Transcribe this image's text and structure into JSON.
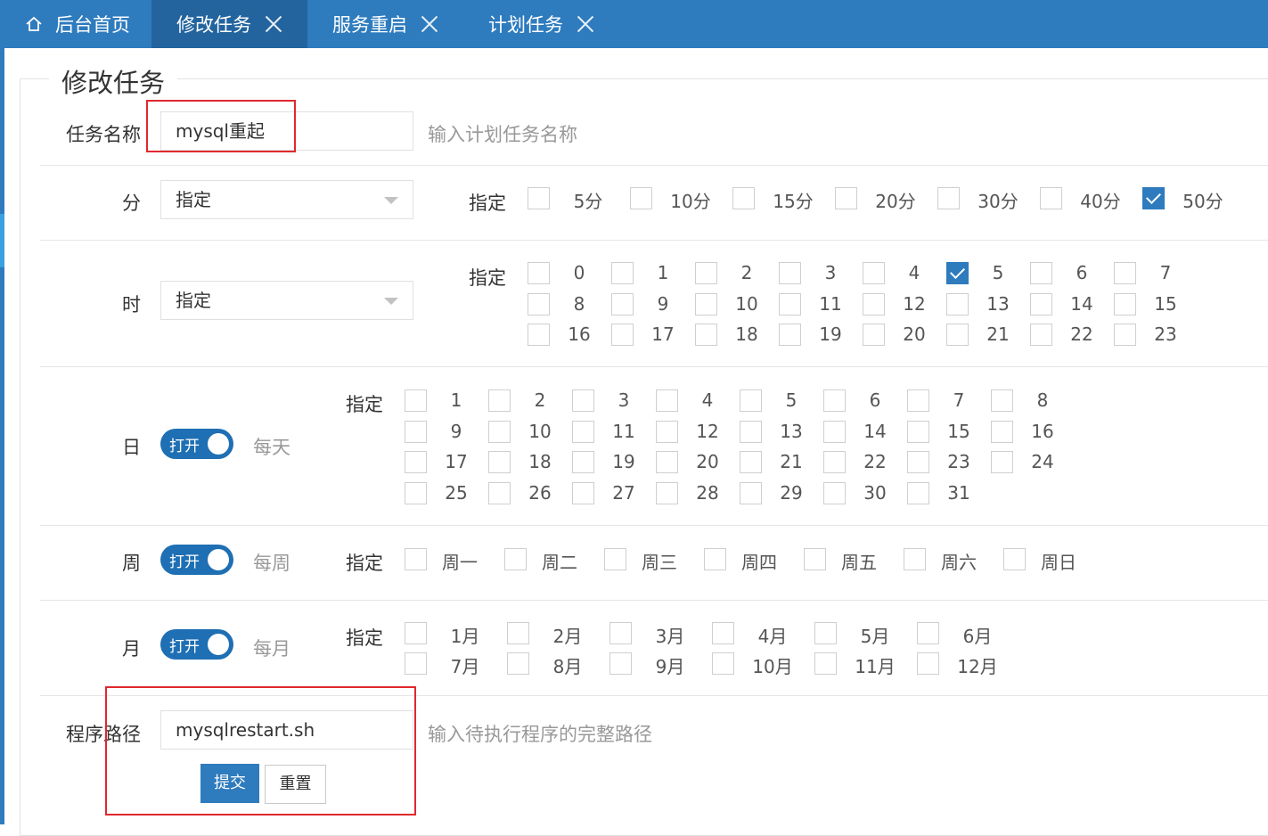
{
  "tabs": [
    {
      "label": "后台首页",
      "icon": "home-icon"
    },
    {
      "label": "修改任务",
      "active": true
    },
    {
      "label": "服务重启"
    },
    {
      "label": "计划任务"
    }
  ],
  "form": {
    "legend": "修改任务",
    "task_name": {
      "label": "任务名称",
      "value": "mysql重起",
      "hint": "输入计划任务名称"
    },
    "minute": {
      "label": "分",
      "select": "指定",
      "spec_label": "指定",
      "options": [
        "5分",
        "10分",
        "15分",
        "20分",
        "30分",
        "40分",
        "50分"
      ],
      "checked": [
        "50分"
      ]
    },
    "hour": {
      "label": "时",
      "select": "指定",
      "spec_label": "指定",
      "options": [
        "0",
        "1",
        "2",
        "3",
        "4",
        "5",
        "6",
        "7",
        "8",
        "9",
        "10",
        "11",
        "12",
        "13",
        "14",
        "15",
        "16",
        "17",
        "18",
        "19",
        "20",
        "21",
        "22",
        "23"
      ],
      "checked": [
        "5"
      ]
    },
    "day": {
      "label": "日",
      "toggle": "打开",
      "every": "每天",
      "spec_label": "指定",
      "options": [
        "1",
        "2",
        "3",
        "4",
        "5",
        "6",
        "7",
        "8",
        "9",
        "10",
        "11",
        "12",
        "13",
        "14",
        "15",
        "16",
        "17",
        "18",
        "19",
        "20",
        "21",
        "22",
        "23",
        "24",
        "25",
        "26",
        "27",
        "28",
        "29",
        "30",
        "31"
      ]
    },
    "week": {
      "label": "周",
      "toggle": "打开",
      "every": "每周",
      "spec_label": "指定",
      "options": [
        "周一",
        "周二",
        "周三",
        "周四",
        "周五",
        "周六",
        "周日"
      ]
    },
    "month": {
      "label": "月",
      "toggle": "打开",
      "every": "每月",
      "spec_label": "指定",
      "options": [
        "1月",
        "2月",
        "3月",
        "4月",
        "5月",
        "6月",
        "7月",
        "8月",
        "9月",
        "10月",
        "11月",
        "12月"
      ]
    },
    "program": {
      "label": "程序路径",
      "value": "mysqlrestart.sh",
      "hint": "输入待执行程序的完整路径"
    },
    "submit_label": "提交",
    "reset_label": "重置"
  },
  "colors": {
    "accent": "#2e7bbe",
    "annotation": "#e0282e"
  }
}
